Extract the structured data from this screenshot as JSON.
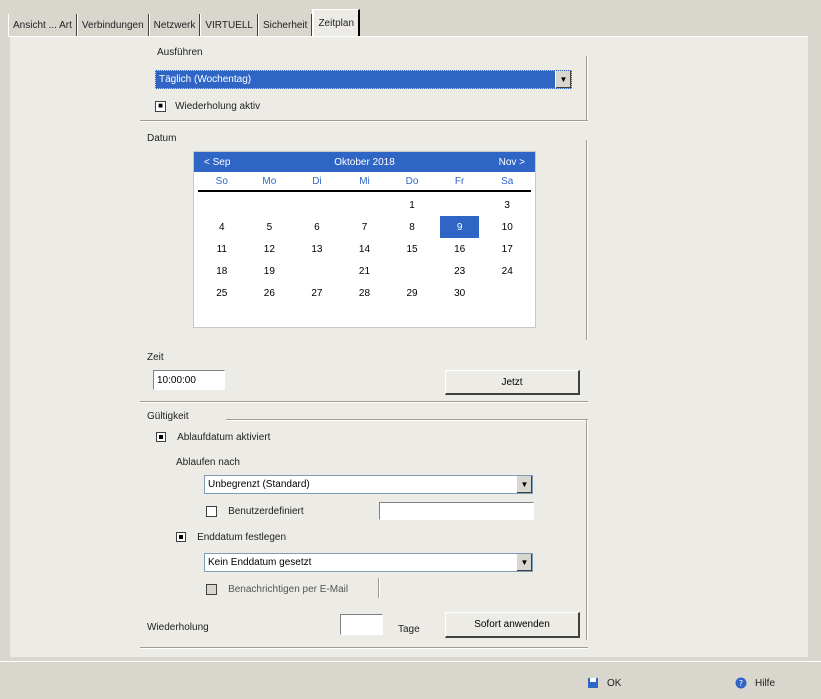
{
  "tabs": [
    {
      "label": "Ansicht ... Art"
    },
    {
      "label": "Verbindungen"
    },
    {
      "label": "Netzwerk"
    },
    {
      "label": "VIRTUELL"
    },
    {
      "label": "Sicherheit"
    },
    {
      "label": "Zeitplan",
      "active": true
    }
  ],
  "schedule": {
    "label": "Ausführen",
    "value": "Täglich (Wochentag)",
    "repeat_label": "Wiederholung aktiv"
  },
  "date": {
    "label": "Datum",
    "month_title": "Oktober 2018",
    "prev": "< Sep",
    "next": "Nov >",
    "dow": [
      "So",
      "Mo",
      "Di",
      "Mi",
      "Do",
      "Fr",
      "Sa"
    ],
    "days": [
      "",
      "",
      "",
      "",
      "1",
      "",
      "3",
      "4",
      "5",
      "6",
      "7",
      "8",
      "9",
      "10",
      "11",
      "12",
      "13",
      "14",
      "15",
      "16",
      "17",
      "18",
      "19",
      "",
      "21",
      "",
      "23",
      "24",
      "25",
      "26",
      "27",
      "28",
      "29",
      "30",
      ""
    ],
    "selected": "9"
  },
  "time": {
    "label": "Zeit",
    "value": "10:00:00",
    "now_button": "Jetzt"
  },
  "expiry": {
    "label": "Gültigkeit",
    "option_expiry_label": "Ablaufdatum aktiviert",
    "expire_after_label": "Ablaufen nach",
    "expire_after_value": "Unbegrenzt (Standard)",
    "custom_label": "Benutzerdefiniert",
    "custom_value": "",
    "option_end_label": "Enddatum festlegen",
    "end_value": "Kein Enddatum gesetzt",
    "notify_label": "Benachrichtigen per E-Mail",
    "retry_label": "Wiederholung",
    "retry_value": "",
    "retry_unit": "Tage",
    "apply_button": "Sofort anwenden"
  },
  "footer": {
    "ok_label": "OK",
    "help_label": "Hilfe"
  },
  "colors": {
    "accent": "#2f66c6",
    "panel": "#ecebe6",
    "chrome": "#d9d6ce"
  }
}
